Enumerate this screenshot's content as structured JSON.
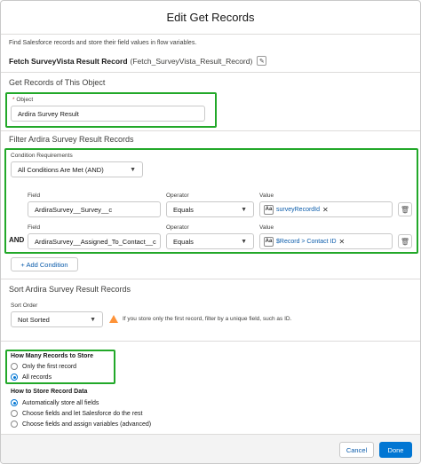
{
  "modal": {
    "title": "Edit Get Records",
    "description": "Find Salesforce records and store their field values in flow variables.",
    "element_label": "Fetch SurveyVista Result Record",
    "element_api_name": "(Fetch_SurveyVista_Result_Record)"
  },
  "get_records": {
    "section_title": "Get Records of This Object",
    "object_label": "Object",
    "object_value": "Ardira Survey Result"
  },
  "filter": {
    "section_title": "Filter Ardira Survey Result Records",
    "condition_label": "Condition Requirements",
    "condition_value": "All Conditions Are Met (AND)",
    "field_label": "Field",
    "operator_label": "Operator",
    "value_label": "Value",
    "rows": [
      {
        "prefix": "",
        "field": "ArdiraSurvey__Survey__c",
        "operator": "Equals",
        "value": "surveyRecordId"
      },
      {
        "prefix": "AND",
        "field": "ArdiraSurvey__Assigned_To_Contact__c",
        "operator": "Equals",
        "value": "$Record > Contact ID"
      }
    ],
    "add_condition": "+ Add Condition"
  },
  "sort": {
    "section_title": "Sort Ardira Survey Result Records",
    "order_label": "Sort Order",
    "order_value": "Not Sorted",
    "warning": "If you store only the first record, filter by a unique field, such as ID."
  },
  "records_to_store": {
    "title": "How Many Records to Store",
    "options": [
      "Only the first record",
      "All records"
    ],
    "selected": 1
  },
  "store_data": {
    "title": "How to Store Record Data",
    "options": [
      "Automatically store all fields",
      "Choose fields and let Salesforce do the rest",
      "Choose fields and assign variables (advanced)"
    ],
    "selected": 0
  },
  "footer": {
    "cancel": "Cancel",
    "done": "Done"
  },
  "colors": {
    "highlight": "#22a829",
    "brand": "#0176d3",
    "link": "#0b5cab"
  }
}
